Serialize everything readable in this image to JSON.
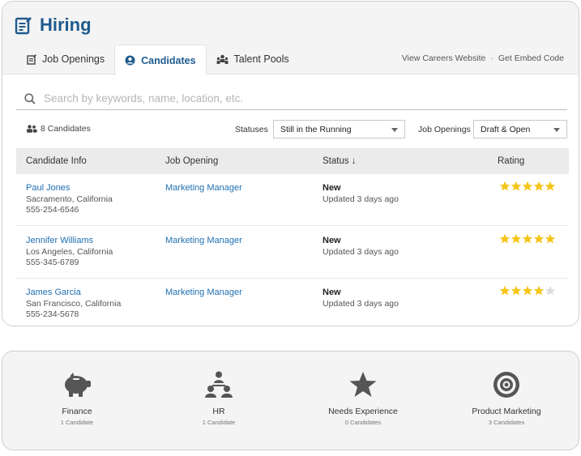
{
  "app": {
    "title": "Hiring"
  },
  "tabs": [
    {
      "label": "Job Openings",
      "icon": "clipboard-icon",
      "active": false
    },
    {
      "label": "Candidates",
      "icon": "user-circle-icon",
      "active": true
    },
    {
      "label": "Talent Pools",
      "icon": "people-icon",
      "active": false
    }
  ],
  "header_links": {
    "careers": "View Careers Website",
    "separator": "·",
    "embed": "Get Embed Code"
  },
  "search": {
    "placeholder": "Search by keywords, name, location, etc.",
    "value": ""
  },
  "filters": {
    "count": "8 Candidates",
    "statuses_label": "Statuses",
    "statuses_value": "Still in the Running",
    "openings_label": "Job Openings",
    "openings_value": "Draft & Open"
  },
  "table": {
    "headers": [
      "Candidate Info",
      "Job Opening",
      "Status ↓",
      "Rating"
    ],
    "rows": [
      {
        "name": "Paul Jones",
        "location": "Sacramento, California",
        "phone": "555-254-6546",
        "job": "Marketing Manager",
        "status": "New",
        "updated": "Updated 3 days ago",
        "rating": 5
      },
      {
        "name": "Jennifer Williams",
        "location": "Los Angeles, California",
        "phone": "555-345-6789",
        "job": "Marketing Manager",
        "status": "New",
        "updated": "Updated 3 days ago",
        "rating": 5
      },
      {
        "name": "James Garcia",
        "location": "San Francisco, California",
        "phone": "555-234-5678",
        "job": "Marketing Manager",
        "status": "New",
        "updated": "Updated 3 days ago",
        "rating": 4
      }
    ]
  },
  "pools": [
    {
      "name": "Finance",
      "count": "1 Candidate",
      "icon": "piggy-bank-icon"
    },
    {
      "name": "HR",
      "count": "1 Candidate",
      "icon": "org-chart-icon"
    },
    {
      "name": "Needs Experience",
      "count": "0 Candidates",
      "icon": "star-icon"
    },
    {
      "name": "Product Marketing",
      "count": "3 Candidates",
      "icon": "target-icon"
    }
  ],
  "colors": {
    "brand": "#1f5b8e",
    "link": "#1f6fb0",
    "star_on": "#f5c518",
    "star_off": "#dddddd",
    "icon_gray": "#555555"
  }
}
